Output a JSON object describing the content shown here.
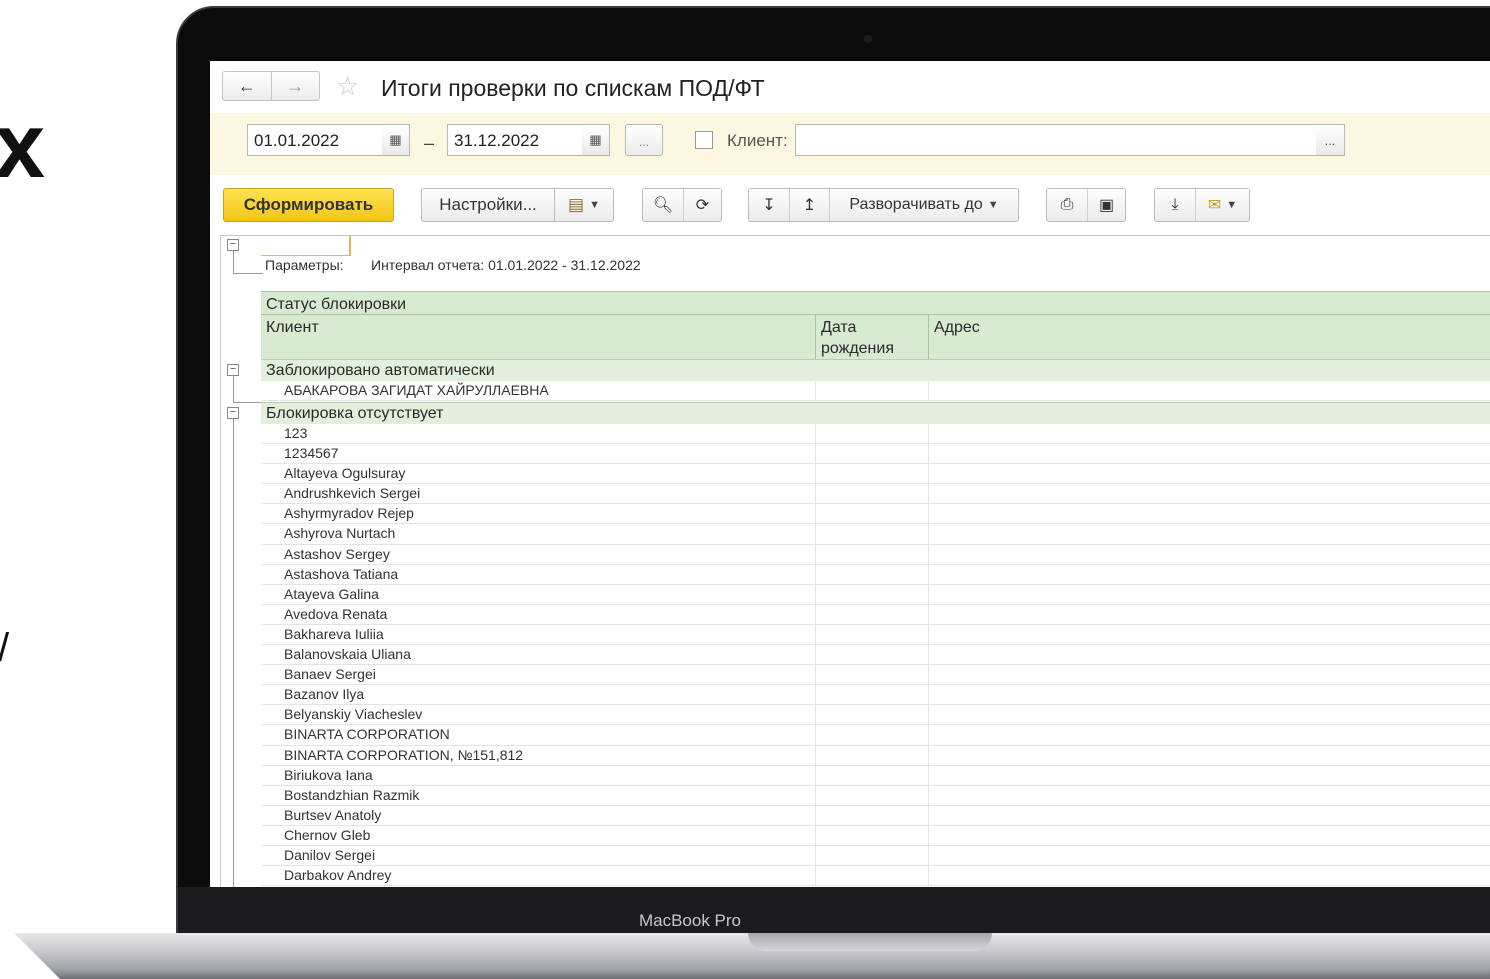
{
  "device": {
    "label": "MacBook Pro"
  },
  "page_fragments": {
    "big_glyph": "х",
    "small_glyph": "/"
  },
  "window": {
    "title": "Итоги проверки по спискам ПОД/ФТ",
    "nav": {
      "back": "←",
      "forward": "→"
    },
    "star": "☆"
  },
  "filters": {
    "date_from": "01.01.2022",
    "date_to": "31.12.2022",
    "dash": "–",
    "period_btn": "...",
    "client_label": "Клиент:",
    "client_value": "",
    "client_btn": "..."
  },
  "toolbar": {
    "generate": "Сформировать",
    "settings": "Настройки...",
    "expand_to": "Разворачивать до"
  },
  "report": {
    "params_label": "Параметры:",
    "params_value": "Интервал отчета: 01.01.2022 - 31.12.2022",
    "header": {
      "status": "Статус блокировки",
      "client": "Клиент",
      "birth_date": "Дата рождения",
      "address": "Адрес"
    },
    "group1": {
      "title": "Заблокировано автоматически",
      "rows": [
        "АБАКАРОВА ЗАГИДАТ ХАЙРУЛЛАЕВНА"
      ]
    },
    "group2": {
      "title": "Блокировка отсутствует",
      "rows": [
        "123",
        "1234567",
        "Altayeva Ogulsuray",
        "Andrushkevich Sergei",
        "Ashyrmyradov Rejep",
        "Ashyrova Nurtach",
        "Astashov Sergey",
        "Astashova Tatiana",
        "Atayeva Galina",
        "Avedova Renata",
        "Bakhareva Iuliia",
        "Balanovskaia Uliana",
        "Banaev Sergei",
        "Bazanov Ilya",
        "Belyanskiy Viacheslev",
        "BINARTA CORPORATION",
        "BINARTA CORPORATION, №151,812",
        "Biriukova Iana",
        "Bostandzhian Razmik",
        "Burtsev Anatoly",
        "Chernov Gleb",
        "Danilov Sergei",
        "Darbakov Andrey"
      ]
    }
  },
  "colors": {
    "primary_button": "#f5cc1e",
    "filter_bar": "#fbf7e1",
    "header_green": "#d9ead3",
    "accent_blue": "#2c6fb8"
  }
}
